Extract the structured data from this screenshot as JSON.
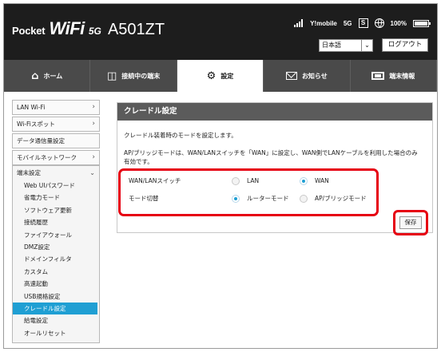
{
  "brand": {
    "pocket": "Pocket",
    "wifi": "WiFi",
    "fiveg": "5G",
    "model": "A501ZT"
  },
  "status": {
    "signal_label": "Y!mobile",
    "network": "5G",
    "sim": "S",
    "battery": "100%",
    "battery_level": 1.0
  },
  "header": {
    "language": "日本語",
    "logout": "ログアウト"
  },
  "nav": {
    "tabs": [
      {
        "label": "ホーム",
        "icon": "home-icon"
      },
      {
        "label": "接続中の端末",
        "icon": "connected-devices-icon"
      },
      {
        "label": "設定",
        "icon": "gear-icon",
        "active": true
      },
      {
        "label": "お知らせ",
        "icon": "mail-icon"
      },
      {
        "label": "端末情報",
        "icon": "device-info-icon"
      }
    ]
  },
  "sidebar": {
    "top_items": [
      {
        "label": "LAN Wi-Fi",
        "chevron": "›"
      },
      {
        "label": "Wi-Fiスポット",
        "chevron": "›"
      },
      {
        "label": "データ通信量設定",
        "chevron": ""
      },
      {
        "label": "モバイルネットワーク",
        "chevron": "›"
      }
    ],
    "group_title": "端末設定",
    "group_chevron": "⌄",
    "sub_items": [
      "Web UIパスワード",
      "省電力モード",
      "ソフトウェア更新",
      "接続履歴",
      "ファイアウォール",
      "DMZ設定",
      "ドメインフィルタ",
      "カスタム",
      "高速起動",
      "USB規格設定",
      "クレードル設定",
      "給電設定",
      "オールリセット"
    ],
    "active_sub_item": 10
  },
  "panel": {
    "title": "クレードル設定",
    "description": "クレードル装着時のモードを設定します。",
    "note": "AP/ブリッジモードは、WAN/LANスイッチを「WAN」に設定し、WAN側でLANケーブルを利用した場合のみ有効です。",
    "rows": [
      {
        "label": "WAN/LANスイッチ",
        "options": [
          "LAN",
          "WAN"
        ],
        "selected": 1
      },
      {
        "label": "モード切替",
        "options": [
          "ルーターモード",
          "AP/ブリッジモード"
        ],
        "selected": 0
      }
    ],
    "save": "保存"
  },
  "colors": {
    "accent": "#1f9fd3",
    "highlight": "#e60012",
    "header": "#1d1d1d",
    "nav": "#4a4a4a"
  }
}
